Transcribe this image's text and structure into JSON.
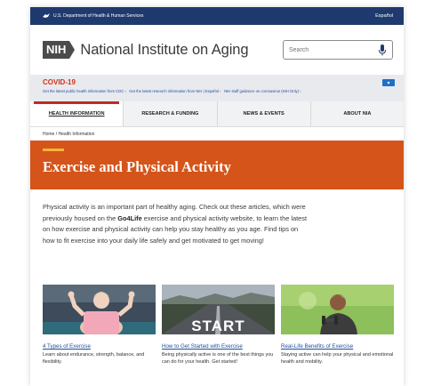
{
  "gov_bar": {
    "agency": "U.S. Department of Health & Human Services",
    "language": "Español"
  },
  "header": {
    "badge": "NIH",
    "title": "National Institute on Aging",
    "search_placeholder": "Search"
  },
  "covid": {
    "title": "COVID-19",
    "links": [
      "Get the latest public health information from CDC ›",
      "Get the latest research information from NIH | Español ›",
      "NIH staff guidance on coronavirus (NIH Only) ›"
    ]
  },
  "nav": {
    "items": [
      "HEALTH INFORMATION",
      "RESEARCH & FUNDING",
      "NEWS & EVENTS",
      "ABOUT NIA"
    ],
    "active": "HEALTH INFORMATION"
  },
  "breadcrumb": {
    "items": [
      "Home",
      "Health Information"
    ],
    "separator": "/"
  },
  "hero": {
    "title": "Exercise and Physical Activity"
  },
  "intro": {
    "before": "Physical activity is an important part of healthy aging. Check out these articles, which were previously housed on the ",
    "bold": "Go4Life",
    "after": " exercise and physical activity website, to learn the latest on how exercise and physical activity can help you stay healthy as you age. Find tips on how to fit exercise into your daily life safely and get motivated to get moving!"
  },
  "cards": [
    {
      "title": "4 Types of Exercise",
      "desc": "Learn about endurance, strength, balance, and flexibility."
    },
    {
      "title": "How to Get Started with Exercise",
      "desc": "Being physically active is one of the best things you can do for your health. Get started!",
      "image_text": "START"
    },
    {
      "title": "Real-Life Benefits of Exercise",
      "desc": "Staying active can help your physical and emotional health and mobility."
    }
  ],
  "colors": {
    "gov_bar": "#1f3a6e",
    "hero": "#d4541a",
    "hero_accent": "#f7b43a",
    "covid_title": "#d1321c",
    "nav_active": "#c0292a",
    "link": "#1f4e9c"
  }
}
